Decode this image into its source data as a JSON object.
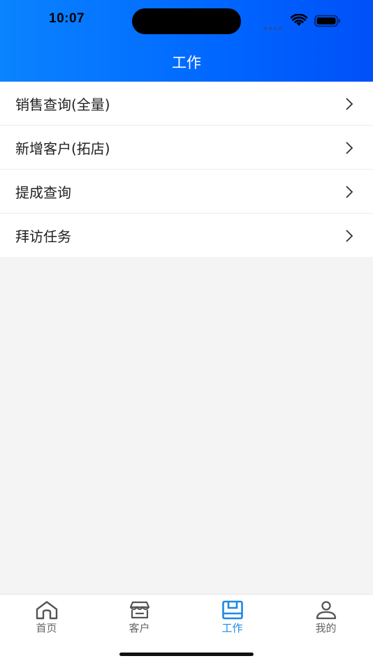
{
  "status_bar": {
    "time": "10:07"
  },
  "header": {
    "title": "工作"
  },
  "menu": {
    "items": [
      {
        "label": "销售查询(全量)"
      },
      {
        "label": "新增客户(拓店)"
      },
      {
        "label": "提成查询"
      },
      {
        "label": "拜访任务"
      }
    ]
  },
  "tabbar": {
    "tabs": [
      {
        "label": "首页",
        "icon": "home-icon"
      },
      {
        "label": "客户",
        "icon": "store-icon"
      },
      {
        "label": "工作",
        "icon": "work-icon",
        "active": true
      },
      {
        "label": "我的",
        "icon": "person-icon"
      }
    ]
  },
  "colors": {
    "header_start": "#0a84ff",
    "header_end": "#0050f8",
    "active_tab": "#1e88e5",
    "inactive_tab": "#666666",
    "background": "#f4f4f4"
  }
}
